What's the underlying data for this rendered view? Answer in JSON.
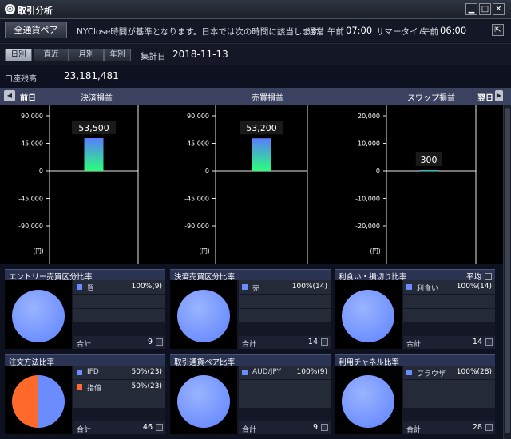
{
  "window": {
    "title": "取引分析",
    "minimize": "▁",
    "restore": "□",
    "close": "✕"
  },
  "header": {
    "pair_button": "全通貨ペア",
    "note": "NYClose時間が基準となります。日本では次の時間に該当します。",
    "standard_label": "通常",
    "standard_ampm": "午前",
    "standard_time": "07:00",
    "summer_label": "サマータイム",
    "summer_ampm": "午前",
    "summer_time": "06:00",
    "popout": "⇱"
  },
  "period": {
    "tabs": [
      "日別",
      "直近",
      "月別",
      "年別"
    ],
    "active_tab": "日別",
    "date_label": "集計日",
    "date": "2018-11-13"
  },
  "balance": {
    "label": "口座残高",
    "value": "23,181,481"
  },
  "section": {
    "prev": "前日",
    "next": "翌日",
    "headers": [
      "決済損益",
      "売買損益",
      "スワップ損益"
    ]
  },
  "chart_data": [
    {
      "type": "bar",
      "title": "決済損益",
      "categories": [
        ""
      ],
      "values": [
        53500
      ],
      "value_label": "53,500",
      "ylim": [
        -90000,
        90000
      ],
      "yticks": [
        "90,000",
        "45,000",
        "0",
        "-45,000",
        "-90,000"
      ],
      "unit": "(円)"
    },
    {
      "type": "bar",
      "title": "売買損益",
      "categories": [
        ""
      ],
      "values": [
        53200
      ],
      "value_label": "53,200",
      "ylim": [
        -90000,
        90000
      ],
      "yticks": [
        "90,000",
        "45,000",
        "0",
        "-45,000",
        "-90,000"
      ],
      "unit": "(円)"
    },
    {
      "type": "bar",
      "title": "スワップ損益",
      "categories": [
        ""
      ],
      "values": [
        300
      ],
      "value_label": "300",
      "ylim": [
        -20000,
        20000
      ],
      "yticks": [
        "20,000",
        "10,000",
        "0",
        "-10,000",
        "-20,000"
      ],
      "unit": "(円)"
    }
  ],
  "panels": [
    {
      "title": "エントリー売買区分比率",
      "items": [
        {
          "name": "買",
          "pct": "100%(9)",
          "color": "#6a8cff"
        }
      ],
      "total_label": "合計",
      "total": "9"
    },
    {
      "title": "決済売買区分比率",
      "items": [
        {
          "name": "売",
          "pct": "100%(14)",
          "color": "#6a8cff"
        }
      ],
      "total_label": "合計",
      "total": "14"
    },
    {
      "title": "利食い・損切り比率",
      "avg_label": "平均",
      "items": [
        {
          "name": "利食い",
          "pct": "100%(14)",
          "color": "#6a8cff"
        }
      ],
      "total_label": "合計",
      "total": "14"
    },
    {
      "title": "注文方法比率",
      "items": [
        {
          "name": "IFD",
          "pct": "50%(23)",
          "color": "#6a8cff"
        },
        {
          "name": "指値",
          "pct": "50%(23)",
          "color": "#ff6a2a"
        }
      ],
      "total_label": "合計",
      "total": "46"
    },
    {
      "title": "取引通貨ペア比率",
      "items": [
        {
          "name": "AUD/JPY",
          "pct": "100%(9)",
          "color": "#6a8cff"
        }
      ],
      "total_label": "合計",
      "total": "9"
    },
    {
      "title": "利用チャネル比率",
      "items": [
        {
          "name": "ブラウザ",
          "pct": "100%(28)",
          "color": "#6a8cff"
        }
      ],
      "total_label": "合計",
      "total": "28"
    }
  ],
  "colors": {
    "accent_blue": "#6a8cff",
    "accent_orange": "#ff6a2a",
    "bar_top": "#5a7cff",
    "bar_bottom": "#2aff7a"
  }
}
